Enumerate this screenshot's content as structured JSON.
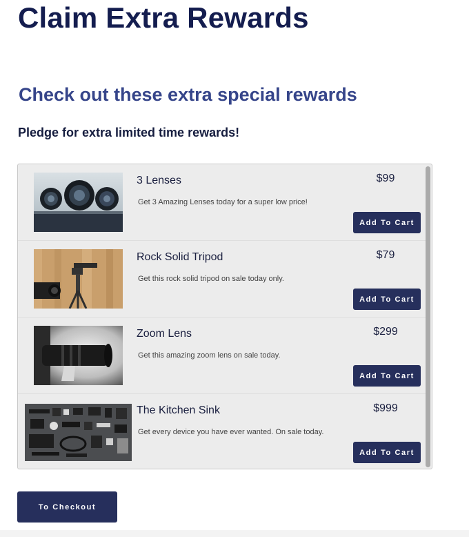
{
  "header": {
    "title": "Claim Extra Rewards"
  },
  "section": {
    "heading": "Check out these extra special rewards",
    "subheading": "Pledge for extra limited time rewards!"
  },
  "rewards": [
    {
      "name": "3 Lenses",
      "description": "Get 3 Amazing Lenses today for a super low price!",
      "price": "$99",
      "button_label": "Add To Cart"
    },
    {
      "name": "Rock Solid Tripod",
      "description": "Get this rock solid tripod on sale today only.",
      "price": "$79",
      "button_label": "Add To Cart"
    },
    {
      "name": "Zoom Lens",
      "description": "Get this amazing zoom lens on sale today.",
      "price": "$299",
      "button_label": "Add To Cart"
    },
    {
      "name": "The Kitchen Sink",
      "description": "Get every device you have ever wanted. On sale today.",
      "price": "$999",
      "button_label": "Add To Cart"
    }
  ],
  "checkout": {
    "button_label": "To Checkout"
  },
  "colors": {
    "title": "#141d4f",
    "heading": "#36458a",
    "button": "#262f5c",
    "list_background": "#ececec"
  }
}
